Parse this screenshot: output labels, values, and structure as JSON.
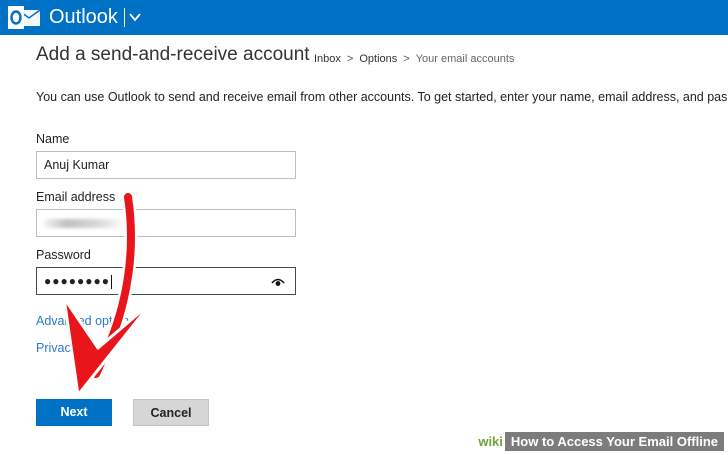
{
  "app": {
    "name": "Outlook",
    "icons": {
      "logo": "outlook-logo-icon",
      "menu": "chevron-down-icon"
    }
  },
  "page": {
    "title": "Add a send-and-receive account",
    "breadcrumb": [
      "Inbox",
      "Options",
      "Your email accounts"
    ],
    "breadcrumb_separator": ">",
    "intro": "You can use Outlook to send and receive email from other accounts. To get started, enter your name, email address, and pas"
  },
  "form": {
    "name": {
      "label": "Name",
      "value": "Anuj Kumar"
    },
    "email": {
      "label": "Email address",
      "value": ""
    },
    "password": {
      "label": "Password",
      "value": "●●●●●●●●",
      "icon": "eye-icon"
    }
  },
  "links": {
    "advanced_options": "Advanced options",
    "privacy": "Privacy"
  },
  "buttons": {
    "next": "Next",
    "cancel": "Cancel"
  },
  "overlay": {
    "arrow_icon": "red-arrow-annotation",
    "watermark_brand": "wiki",
    "watermark_text": "How to Access Your Email Offline"
  },
  "colors": {
    "brand_blue": "#0072c6",
    "link_blue": "#2a7ac9",
    "arrow_red": "#e8151a"
  }
}
